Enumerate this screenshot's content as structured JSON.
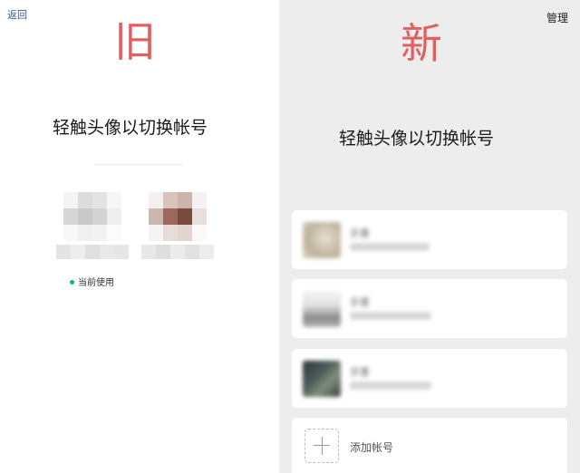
{
  "old": {
    "back_label": "返回",
    "version_label": "旧",
    "headline": "轻触头像以切换帐号",
    "current_badge": "当前使用"
  },
  "new": {
    "version_label": "新",
    "manage_label": "管理",
    "headline": "轻触头像以切换帐号",
    "accounts": [
      {
        "nickname": "示意"
      },
      {
        "nickname": "示意"
      },
      {
        "nickname": "示意"
      }
    ],
    "add_account_label": "添加帐号"
  },
  "colors": {
    "version_label": "#e06060",
    "current_dot": "#07c160",
    "old_background": "#ffffff",
    "new_background": "#ededed"
  },
  "icons": [
    "plus-icon"
  ]
}
